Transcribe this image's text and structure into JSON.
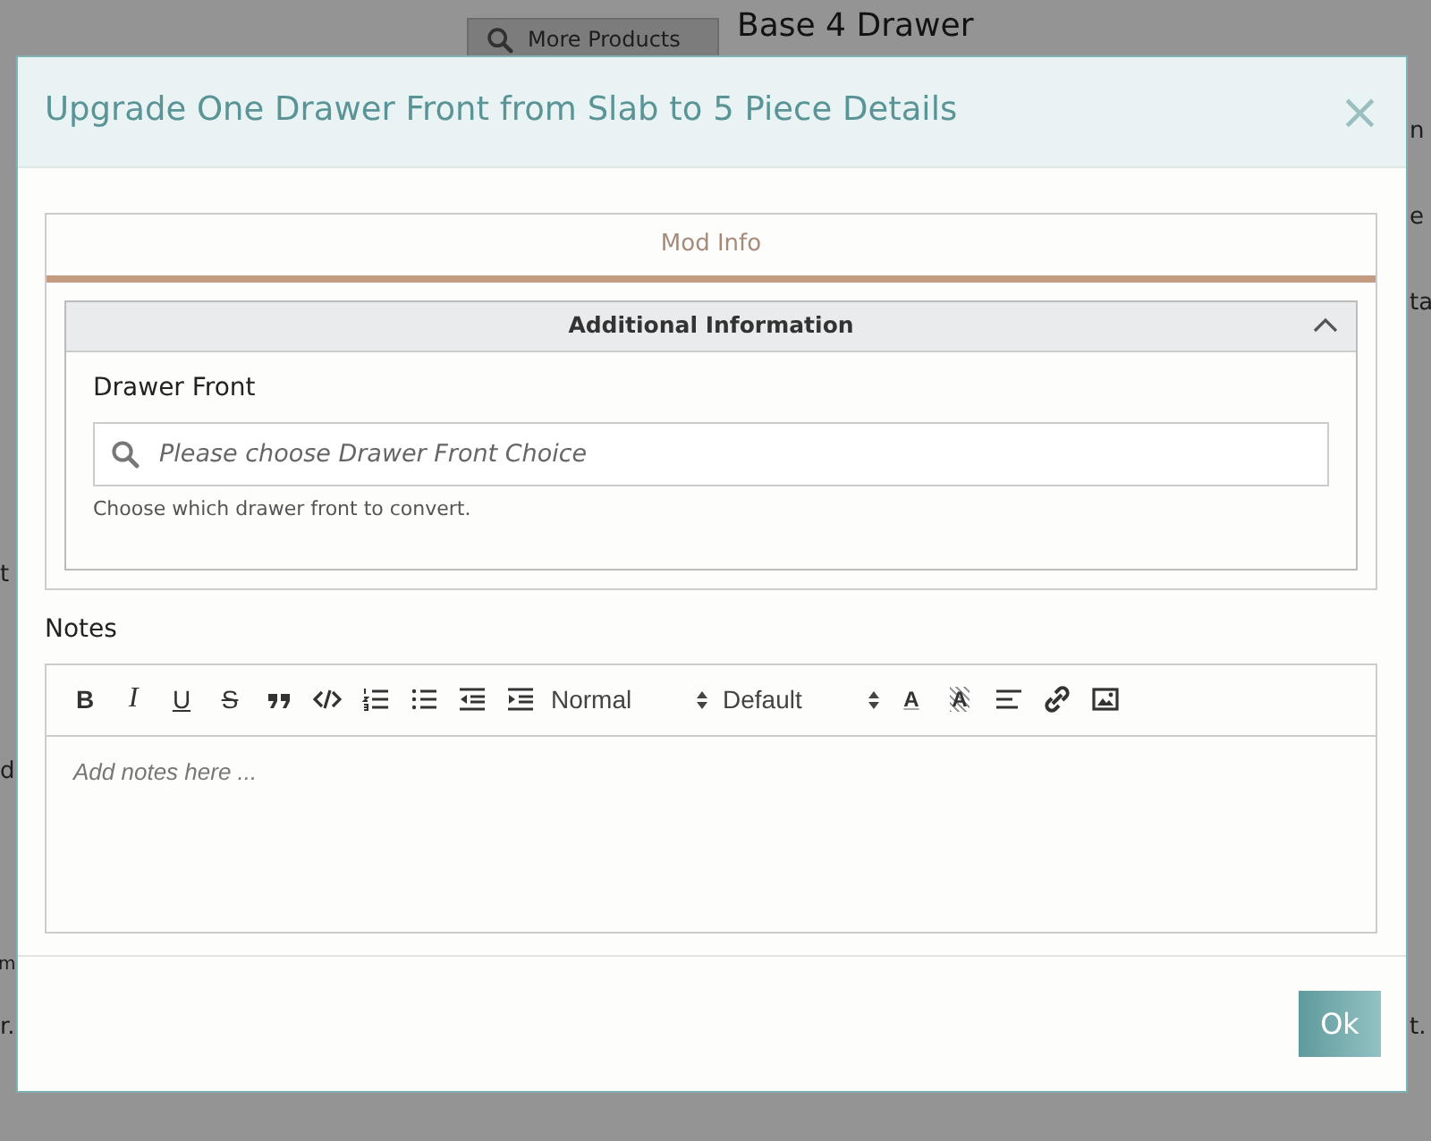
{
  "background": {
    "search_button": "More Products",
    "title": "Base 4 Drawer",
    "left_fragments": [
      "t",
      "d",
      "m",
      "r."
    ],
    "right_fragments": [
      "n",
      "e",
      "ta",
      "t."
    ]
  },
  "modal": {
    "title": "Upgrade One Drawer Front from Slab to 5 Piece Details",
    "close": "×"
  },
  "tabs": [
    {
      "label": "Mod Info",
      "selected": true
    }
  ],
  "section": {
    "title": "Additional Information",
    "expanded": true,
    "field": {
      "label": "Drawer Front",
      "placeholder": "Please choose Drawer Front Choice",
      "help": "Choose which drawer front to convert."
    }
  },
  "notes": {
    "label": "Notes",
    "placeholder": "Add notes here ...",
    "toolbar": [
      {
        "kind": "bold",
        "text": "B"
      },
      {
        "kind": "italic",
        "text": "I"
      },
      {
        "kind": "underline",
        "text": "U"
      },
      {
        "kind": "strike",
        "text": "S"
      },
      {
        "kind": "quote"
      },
      {
        "kind": "code"
      },
      {
        "kind": "ol"
      },
      {
        "kind": "ul"
      },
      {
        "kind": "outdent"
      },
      {
        "kind": "indent"
      },
      {
        "kind": "select",
        "value": "Normal"
      },
      {
        "kind": "select",
        "value": "Default"
      },
      {
        "kind": "color",
        "text": "A"
      },
      {
        "kind": "background",
        "text": "A"
      },
      {
        "kind": "align"
      },
      {
        "kind": "link"
      },
      {
        "kind": "image"
      }
    ]
  },
  "footer": {
    "ok": "Ok"
  }
}
